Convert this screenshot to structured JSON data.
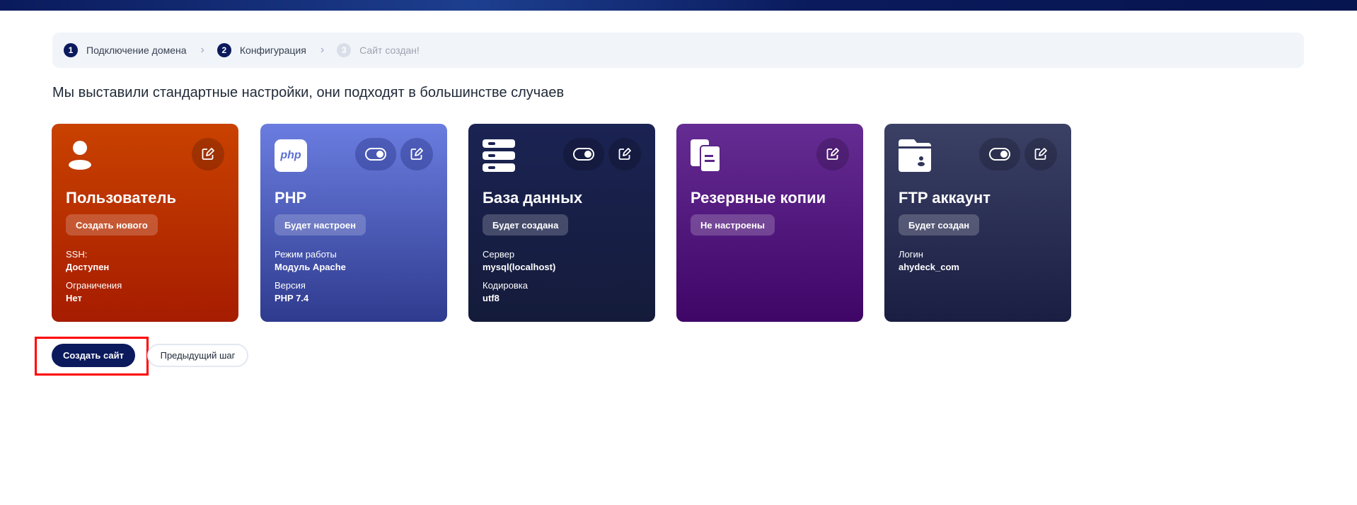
{
  "stepper": {
    "steps": [
      {
        "num": "1",
        "label": "Подключение домена"
      },
      {
        "num": "2",
        "label": "Конфигурация"
      },
      {
        "num": "3",
        "label": "Сайт создан!"
      }
    ]
  },
  "heading": "Мы выставили стандартные настройки, они подходят в большинстве случаев",
  "cards": [
    {
      "title": "Пользователь",
      "badge": "Создать нового",
      "fields": [
        {
          "label": "SSH:",
          "value": "Доступен"
        },
        {
          "label": "Ограничения",
          "value": "Нет"
        }
      ]
    },
    {
      "title": "PHP",
      "icon_text": "php",
      "badge": "Будет настроен",
      "fields": [
        {
          "label": "Режим работы",
          "value": "Модуль Apache"
        },
        {
          "label": "Версия",
          "value": "PHP 7.4"
        }
      ]
    },
    {
      "title": "База данных",
      "badge": "Будет создана",
      "fields": [
        {
          "label": "Сервер",
          "value": "mysql(localhost)"
        },
        {
          "label": "Кодировка",
          "value": "utf8"
        }
      ]
    },
    {
      "title": "Резервные копии",
      "badge": "Не настроены",
      "fields": []
    },
    {
      "title": "FTP аккаунт",
      "badge": "Будет создан",
      "fields": [
        {
          "label": "Логин",
          "value": "ahydeck_com"
        }
      ]
    }
  ],
  "actions": {
    "create": "Создать сайт",
    "prev": "Предыдущий шаг"
  }
}
